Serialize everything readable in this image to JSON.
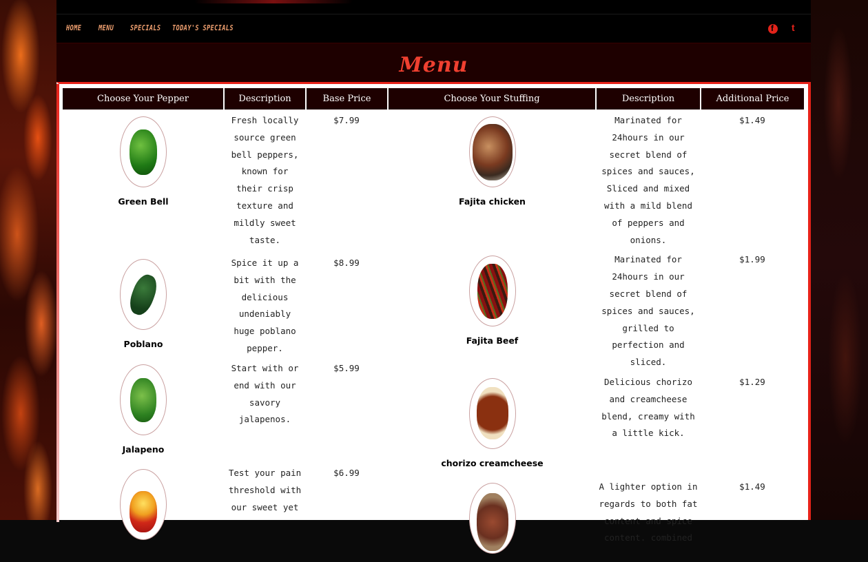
{
  "nav": {
    "home": "HOME",
    "menu": "MENU",
    "specials": "SPECIALS",
    "todays_specials": "TODAY'S SPECIALS"
  },
  "social": {
    "facebook": "f",
    "twitter": "t"
  },
  "page_title": "Menu",
  "peppers": {
    "headers": [
      "Choose Your Pepper",
      "Description",
      "Base Price"
    ],
    "items": [
      {
        "name": "Green Bell",
        "description": "Fresh locally source green bell peppers, known for their crisp texture and mildly sweet taste.",
        "price": "$7.99",
        "icon": "green-bell-pepper-image"
      },
      {
        "name": "Poblano",
        "description": "Spice it up a bit with the delicious undeniably huge poblano pepper.",
        "price": "$8.99",
        "icon": "poblano-pepper-image"
      },
      {
        "name": "Jalapeno",
        "description": "Start with or end with our savory jalapenos.",
        "price": "$5.99",
        "icon": "jalapeno-pepper-image"
      },
      {
        "name": "",
        "description": "Test your pain threshold with our sweet yet",
        "price": "$6.99",
        "icon": "hot-pepper-image"
      }
    ]
  },
  "stuffing": {
    "headers": [
      "Choose Your Stuffing",
      "Description",
      "Additional Price"
    ],
    "items": [
      {
        "name": "Fajita chicken",
        "description": "Marinated for 24hours in our secret blend of spices and sauces, Sliced and mixed with a mild blend of peppers and onions.",
        "price": "$1.49",
        "icon": "fajita-chicken-image"
      },
      {
        "name": "Fajita Beef",
        "description": "Marinated for 24hours in our secret blend of spices and sauces, grilled to perfection and sliced.",
        "price": "$1.99",
        "icon": "fajita-beef-image"
      },
      {
        "name": "chorizo creamcheese",
        "description": "Delicious chorizo and creamcheese blend, creamy with a little kick.",
        "price": "$1.29",
        "icon": "chorizo-creamcheese-image"
      },
      {
        "name": "",
        "description": "A lighter option in regards to both fat content and spice content. combined",
        "price": "$1.49",
        "icon": "veggie-stuffing-image"
      }
    ]
  }
}
